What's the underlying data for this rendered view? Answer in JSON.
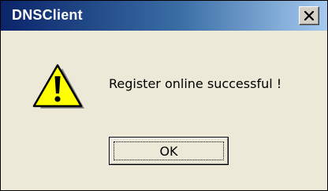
{
  "window": {
    "title": "DNSClient",
    "close_icon": "close-x-icon"
  },
  "dialog": {
    "icon": "warning-triangle-icon",
    "message": "Register online successful !",
    "ok_label": "OK"
  },
  "colors": {
    "titlebar_start": "#0a246a",
    "titlebar_end": "#a6caf0",
    "dialog_bg": "#ece9d8",
    "warning_yellow": "#ffff00"
  }
}
